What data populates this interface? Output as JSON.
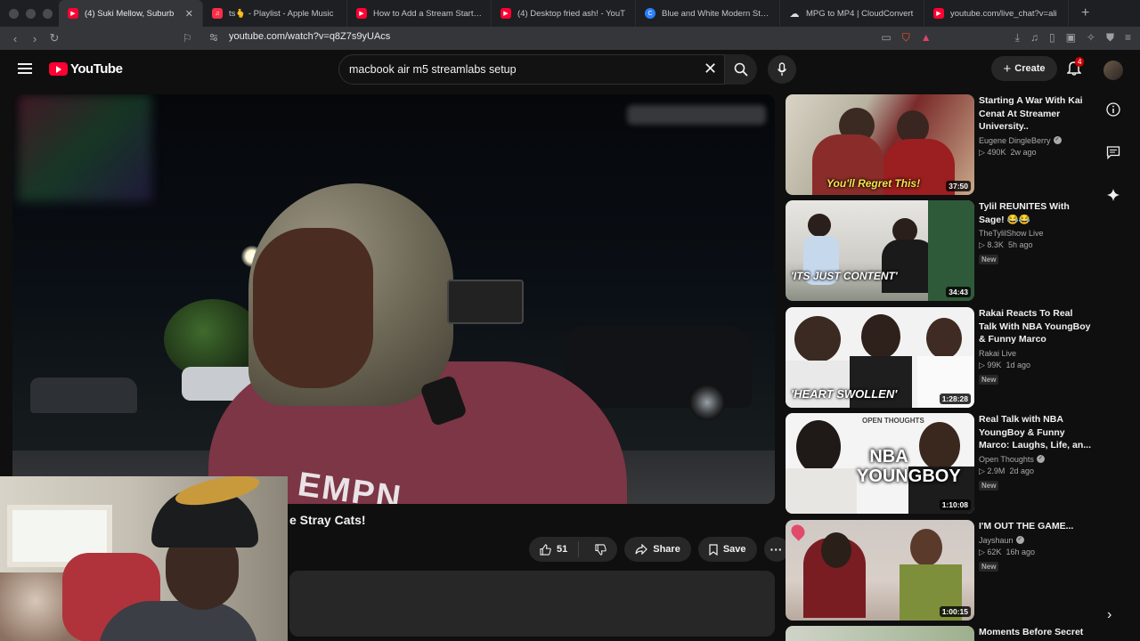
{
  "browser": {
    "tabs": [
      {
        "title": "(4) Suki Mellow, Suburb",
        "icon": "youtube-icon",
        "active": true
      },
      {
        "title": "ts🫰 - Playlist - Apple Music",
        "icon": "apple-music-icon"
      },
      {
        "title": "How to Add a Stream Starting",
        "icon": "youtube-icon"
      },
      {
        "title": "(4) Desktop fried ash! - YouT",
        "icon": "youtube-icon"
      },
      {
        "title": "Blue and White Modern Strea",
        "icon": "canva-icon"
      },
      {
        "title": "MPG to MP4 | CloudConvert",
        "icon": "cloud-icon"
      },
      {
        "title": "youtube.com/live_chat?v=ali",
        "icon": "youtube-icon"
      }
    ],
    "url": "youtube.com/watch?v=q8Z7s9yUAcs"
  },
  "header": {
    "logo": "YouTube",
    "search_value": "macbook air m5 streamlabs setup",
    "create_label": "Create",
    "notification_count": "4"
  },
  "video": {
    "title_visible": "e Stray Cats!",
    "shirt_text": "EMPN",
    "like_count": "51",
    "share_label": "Share",
    "save_label": "Save"
  },
  "recommendations": [
    {
      "title": "Starting A War With Kai Cenat At Streamer University..",
      "channel": "Eugene DingleBerry",
      "verified": true,
      "views": "490K",
      "age": "2w ago",
      "duration": "37:50",
      "thumb_text": "You'll Regret This!",
      "is_new": false
    },
    {
      "title": "Tylil REUNITES With Sage! 😂😂",
      "channel": "TheTylilShow Live",
      "verified": false,
      "views": "8.3K",
      "age": "5h ago",
      "duration": "34:43",
      "thumb_text": "'ITS JUST CONTENT'",
      "is_new": true
    },
    {
      "title": "Rakai Reacts To Real Talk With NBA YoungBoy & Funny Marco",
      "channel": "Rakai Live",
      "verified": false,
      "views": "99K",
      "age": "1d ago",
      "duration": "1:28:28",
      "thumb_text": "'HEART SWOLLEN'",
      "is_new": true
    },
    {
      "title": "Real Talk with NBA YoungBoy & Funny Marco: Laughs, Life, an...",
      "channel": "Open Thoughts",
      "verified": true,
      "views": "2.9M",
      "age": "2d ago",
      "duration": "1:10:08",
      "thumb_text": "NBA YOUNGBOY",
      "thumb_small": "OPEN THOUGHTS",
      "is_new": true
    },
    {
      "title": "I'M OUT THE GAME...",
      "channel": "Jayshaun",
      "verified": true,
      "views": "62K",
      "age": "16h ago",
      "duration": "1:00:15",
      "thumb_text": "",
      "is_new": true
    },
    {
      "title": "Moments Before Secret",
      "channel": "",
      "verified": false,
      "views": "",
      "age": "",
      "duration": "",
      "thumb_text": "",
      "is_new": false
    }
  ],
  "new_label": "New",
  "colors": {
    "accent": "#ff0033",
    "bg": "#0f0f0f",
    "surface": "#272727"
  }
}
